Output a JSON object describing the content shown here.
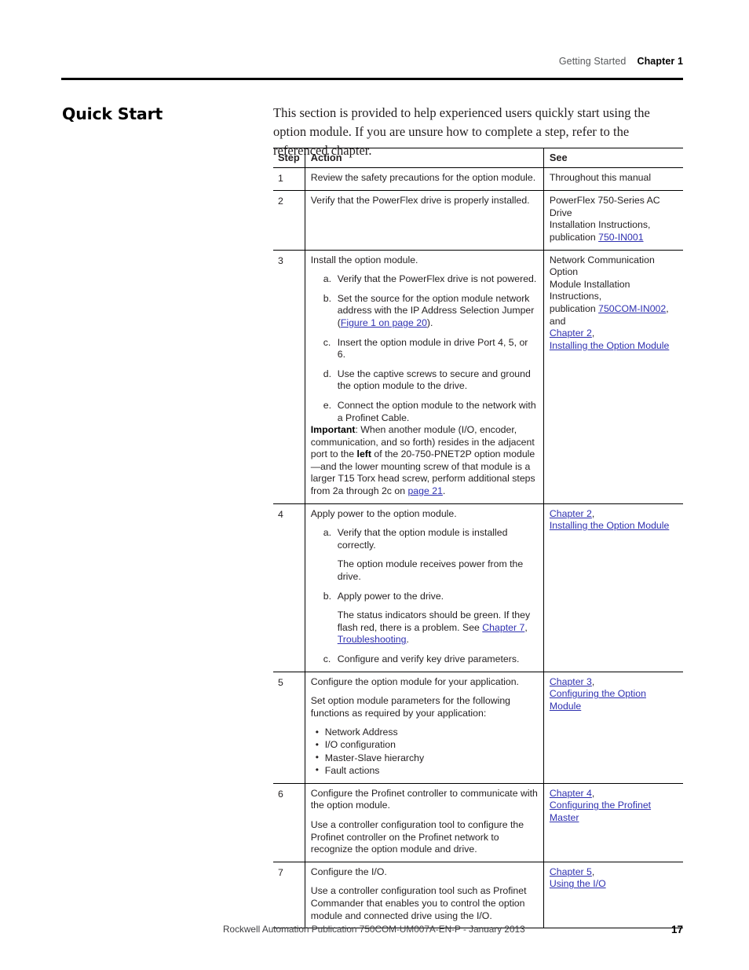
{
  "header": {
    "section": "Getting Started",
    "chapter": "Chapter 1"
  },
  "section_title": "Quick Start",
  "intro": "This section is provided to help experienced users quickly start using the option module. If you are unsure how to complete a step, refer to the referenced chapter.",
  "table": {
    "columns": [
      "Step",
      "Action",
      "See"
    ],
    "rows": [
      {
        "step": "1",
        "action_main": "Review the safety precautions for the option module.",
        "see_plain": "Throughout this manual"
      },
      {
        "step": "2",
        "action_main": "Verify that the PowerFlex drive is properly installed.",
        "see_text_1": "PowerFlex 750-Series AC Drive",
        "see_text_2": "Installation Instructions,",
        "see_text_3_prefix": "publication ",
        "see_link_1": "750-IN001"
      },
      {
        "step": "3",
        "action_main": "Install the option module.",
        "substeps": [
          {
            "letter": "a.",
            "text": "Verify that the PowerFlex drive is not powered."
          },
          {
            "letter": "b.",
            "text_prefix": "Set the source for the option module network address with the IP Address Selection Jumper (",
            "link": "Figure 1 on page 20",
            "text_suffix": ")."
          },
          {
            "letter": "c.",
            "text": "Insert the option module in drive Port 4, 5, or 6."
          },
          {
            "letter": "d.",
            "text": "Use the captive screws to secure and ground the option module to the drive."
          },
          {
            "letter": "e.",
            "text": "Connect the option module to the network with a Profinet Cable."
          }
        ],
        "important": {
          "label": "Important",
          "part_1": ": When another module (I/O, encoder, communication, and so forth) resides in the adjacent port to the ",
          "bold_1": "left",
          "part_2": " of the 20-750-PNET2P option module—and the lower mounting screw of that module is a larger T15 Torx head screw, perform additional steps from 2a through 2c on ",
          "link": "page 21",
          "part_3": "."
        },
        "see_text_1": "Network Communication Option",
        "see_text_2": "Module Installation Instructions,",
        "see_text_3_prefix": "publication ",
        "see_link_1": "750COM-IN002",
        "see_text_3_suffix": ", and",
        "see_link_2": "Chapter 2",
        "see_link_2_suffix": ",",
        "see_link_3": "Installing the Option Module"
      },
      {
        "step": "4",
        "action_main": "Apply power to the option module.",
        "substeps": [
          {
            "letter": "a.",
            "text": "Verify that the option module is installed correctly.",
            "note": "The option module receives power from the drive."
          },
          {
            "letter": "b.",
            "text": "Apply power to the drive.",
            "note_prefix": "The status indicators should be green. If they flash red, there is a problem. See ",
            "note_link_1": "Chapter 7",
            "note_mid": ", ",
            "note_link_2": "Troubleshooting",
            "note_suffix": "."
          },
          {
            "letter": "c.",
            "text": "Configure and verify key drive parameters."
          }
        ],
        "see_link_1": "Chapter 2",
        "see_link_1_suffix": ",",
        "see_link_2": "Installing the Option Module"
      },
      {
        "step": "5",
        "action_main": "Configure the option module for your application.",
        "action_second": "Set option module parameters for the following functions as required by your application:",
        "bullets": [
          "Network Address",
          "I/O configuration",
          "Master-Slave hierarchy",
          "Fault actions"
        ],
        "see_link_1": "Chapter 3",
        "see_link_1_suffix": ",",
        "see_link_2": "Configuring the Option Module"
      },
      {
        "step": "6",
        "action_main": "Configure the Profinet controller to communicate with the option module.",
        "action_second": "Use a controller configuration tool to configure the Profinet controller on the Profinet network to recognize the option module and drive.",
        "see_link_1": "Chapter 4",
        "see_link_1_suffix": ",",
        "see_link_2": "Configuring the Profinet Master"
      },
      {
        "step": "7",
        "action_main": "Configure the I/O.",
        "action_second": "Use a controller configuration tool such as Profinet Commander that enables you to control the option module and connected drive using the I/O.",
        "see_link_1": "Chapter 5",
        "see_link_1_suffix": ",",
        "see_link_2": "Using the I/O"
      }
    ]
  },
  "footer": {
    "publication": "Rockwell Automation Publication 750COM-UM007A-EN-P - January 2013",
    "page_number": "17"
  },
  "colors": {
    "link": "#2f31b0",
    "text": "#231f20",
    "rule": "#000000"
  }
}
